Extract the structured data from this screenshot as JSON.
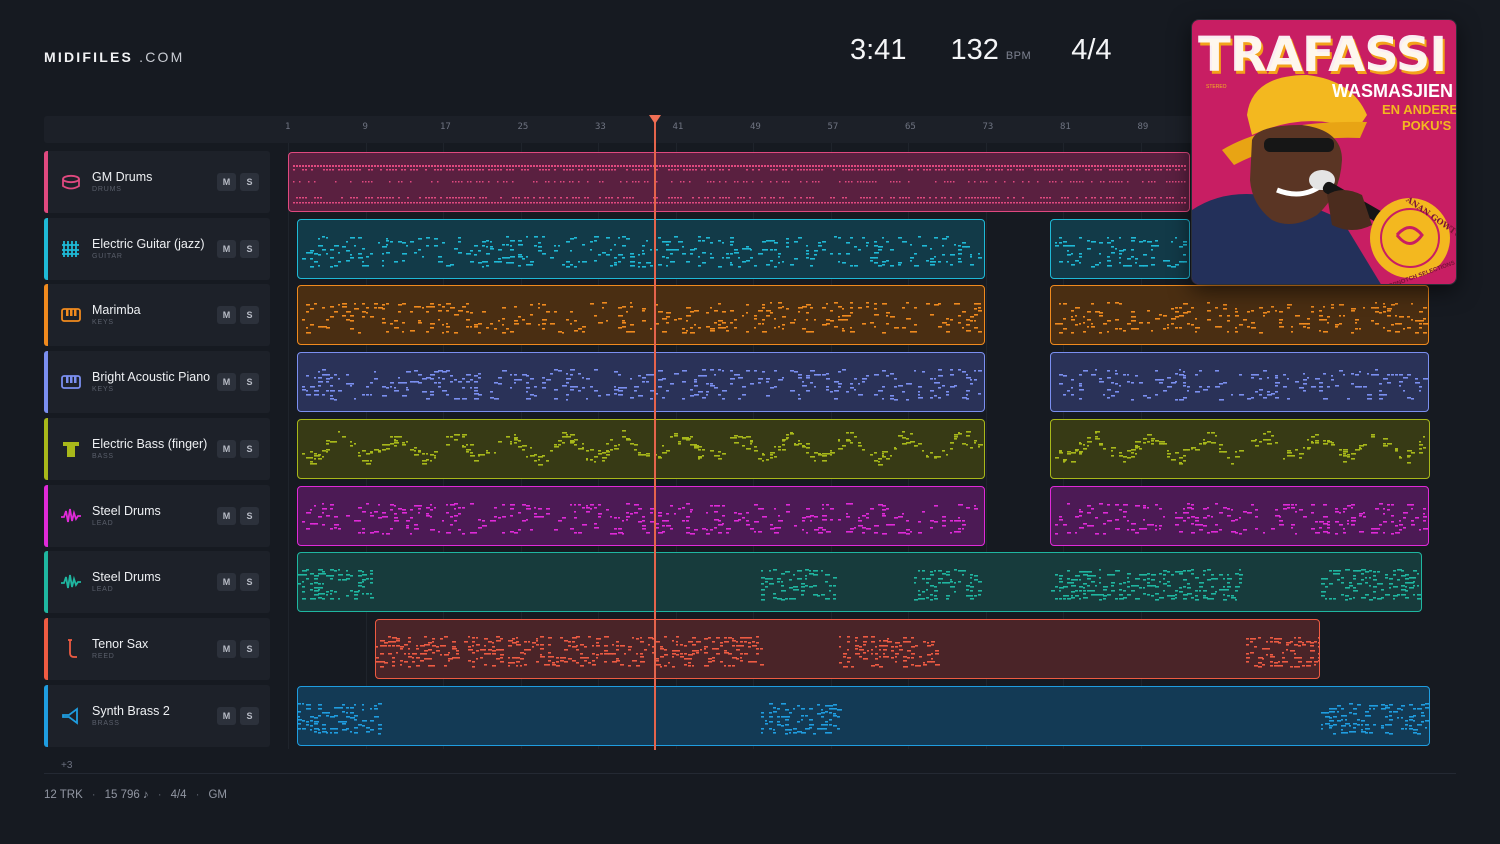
{
  "brand": {
    "name": "MIDIFILES",
    "suffix": ".COM"
  },
  "stats": {
    "time": "3:41",
    "bpm": "132",
    "bpm_unit": "BPM",
    "time_signature": "4/4"
  },
  "ruler": {
    "ticks": [
      "1",
      "9",
      "17",
      "25",
      "33",
      "41",
      "49",
      "57",
      "65",
      "73",
      "81",
      "89"
    ]
  },
  "tracks": [
    {
      "name": "GM Drums",
      "category": "DRUMS",
      "color": "#e0497f",
      "fill": "#5a2040",
      "icon": "drum-icon",
      "m": "M",
      "s": "S"
    },
    {
      "name": "Electric Guitar (jazz)",
      "category": "GUITAR",
      "color": "#1fb9d6",
      "fill": "#123a48",
      "icon": "guitar-icon",
      "m": "M",
      "s": "S"
    },
    {
      "name": "Marimba",
      "category": "KEYS",
      "color": "#f08a1e",
      "fill": "#4a2e12",
      "icon": "marimba-icon",
      "m": "M",
      "s": "S"
    },
    {
      "name": "Bright Acoustic Piano",
      "category": "KEYS",
      "color": "#7b8ff0",
      "fill": "#2a3258",
      "icon": "piano-icon",
      "m": "M",
      "s": "S"
    },
    {
      "name": "Electric Bass (finger)",
      "category": "BASS",
      "color": "#a8b81a",
      "fill": "#373a15",
      "icon": "bass-icon",
      "m": "M",
      "s": "S"
    },
    {
      "name": "Steel Drums",
      "category": "LEAD",
      "color": "#e02ad8",
      "fill": "#4c1a55",
      "icon": "waveform-icon",
      "m": "M",
      "s": "S"
    },
    {
      "name": "Steel Drums",
      "category": "LEAD",
      "color": "#1fb6a0",
      "fill": "#173b3c",
      "icon": "waveform-icon",
      "m": "M",
      "s": "S"
    },
    {
      "name": "Tenor Sax",
      "category": "REED",
      "color": "#ee5b42",
      "fill": "#4a2428",
      "icon": "sax-icon",
      "m": "M",
      "s": "S"
    },
    {
      "name": "Synth Brass 2",
      "category": "BRASS",
      "color": "#1f9de0",
      "fill": "#133a55",
      "icon": "horn-icon",
      "m": "M",
      "s": "S"
    }
  ],
  "more_tracks": "+3",
  "footer": {
    "tracks": "12 TRK",
    "notes": "15 796 ♪",
    "signature": "4/4",
    "format": "GM"
  },
  "album": {
    "title": "TRAFASSI",
    "subtitle": "WASMASJIEN",
    "line2": "EN ANDERE",
    "line3": "POKU'S",
    "stereo": "STEREO",
    "seal_text": "ANAN GOWTU",
    "seal_text2": "TOPNOTCH SELECTIONS",
    "colors": {
      "background": "#c81e63",
      "title": "#ffffff",
      "title_shadow": "#f3a21b",
      "hat": "#f3b81f"
    }
  }
}
